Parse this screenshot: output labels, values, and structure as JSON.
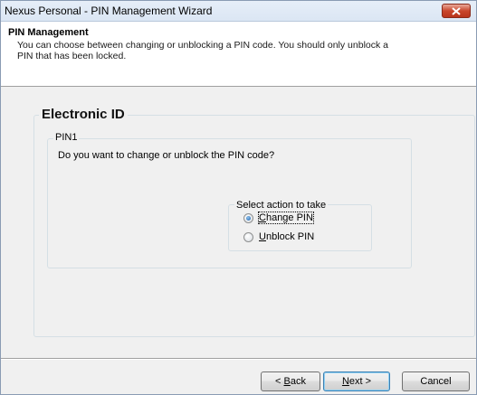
{
  "window": {
    "title": "Nexus Personal - PIN Management Wizard"
  },
  "header": {
    "title": "PIN Management",
    "description": "You can choose between changing or unblocking a PIN code. You should only unblock a PIN that has been locked."
  },
  "electronic_id": {
    "legend": "Electronic ID",
    "pin_group": {
      "legend": "PIN1",
      "question": "Do you want to change or unblock the PIN code?",
      "action_group": {
        "legend": "Select action to take",
        "options": [
          {
            "mnemonic": "C",
            "rest": "hange PIN",
            "checked": true
          },
          {
            "mnemonic": "U",
            "rest": "nblock PIN",
            "checked": false
          }
        ]
      }
    }
  },
  "buttons": {
    "back": {
      "prefix": "< ",
      "mnemonic": "B",
      "rest": "ack"
    },
    "next": {
      "mnemonic": "N",
      "rest": "ext",
      "suffix": " >"
    },
    "cancel": {
      "label": "Cancel"
    }
  },
  "colors": {
    "close_button": "#c9462c",
    "default_button_border": "#3c7fb1",
    "radio_selected": "#1d5fa8"
  },
  "icons": {
    "close": "close-icon"
  }
}
